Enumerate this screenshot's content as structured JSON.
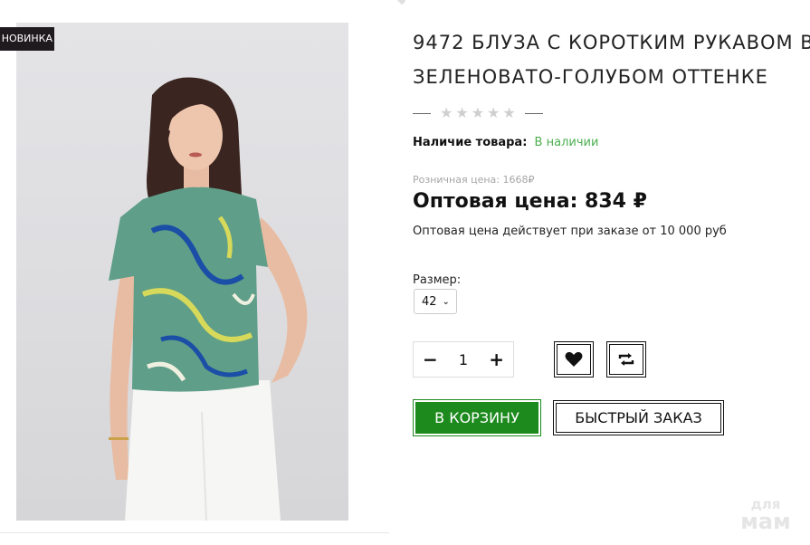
{
  "product": {
    "badge": "НОВИНКА",
    "title": "9472 БЛУЗА С КОРОТКИМ РУКАВОМ В\nЗЕЛЕНОВАТО-ГОЛУБОМ ОТТЕНКЕ",
    "rating": {
      "value": 0,
      "max": 5
    },
    "availability_label": "Наличие товара:",
    "availability_value": "В наличии",
    "retail_price": "Розничная цена: 1668₽",
    "wholesale_price": "Оптовая цена: 834 ₽",
    "wholesale_note": "Оптовая цена действует при заказе от 10 000 руб",
    "size_label": "Размер:",
    "size_selected": "42",
    "quantity": "1",
    "minus_label": "−",
    "plus_label": "+",
    "cart_button": "В КОРЗИНУ",
    "quick_order_button": "БЫСТРЫЙ ЗАКАЗ"
  },
  "watermark": {
    "line1": "для",
    "line2": "мам"
  },
  "colors": {
    "accent_green": "#1d8a1d",
    "in_stock_green": "#4caf50",
    "badge_bg": "#1f1a1e"
  },
  "icons": [
    "heart-icon",
    "compare-icon",
    "chevron-down-icon",
    "star-icon"
  ]
}
